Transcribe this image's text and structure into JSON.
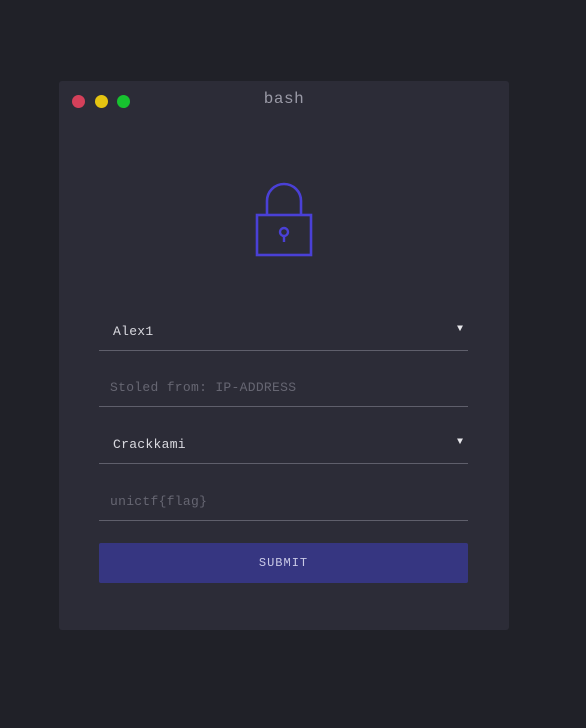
{
  "window": {
    "title": "bash",
    "controls": [
      {
        "name": "close",
        "color": "#d4405a"
      },
      {
        "name": "minimize",
        "color": "#e5c411"
      },
      {
        "name": "maximize",
        "color": "#17c22f"
      }
    ]
  },
  "lock_icon": {
    "name": "lock-icon",
    "color": "#4a40d6"
  },
  "form": {
    "user_select": {
      "value": "Alex1",
      "caret": "▼"
    },
    "ip_input": {
      "value": "",
      "placeholder": "Stoled from: IP-ADDRESS"
    },
    "target_select": {
      "value": "Crackkami",
      "caret": "▼"
    },
    "flag_input": {
      "value": "",
      "placeholder": "unictf{flag}"
    },
    "submit_label": "SUBMIT"
  },
  "colors": {
    "background": "#202128",
    "window": "#2c2c37",
    "accent": "#363681"
  }
}
